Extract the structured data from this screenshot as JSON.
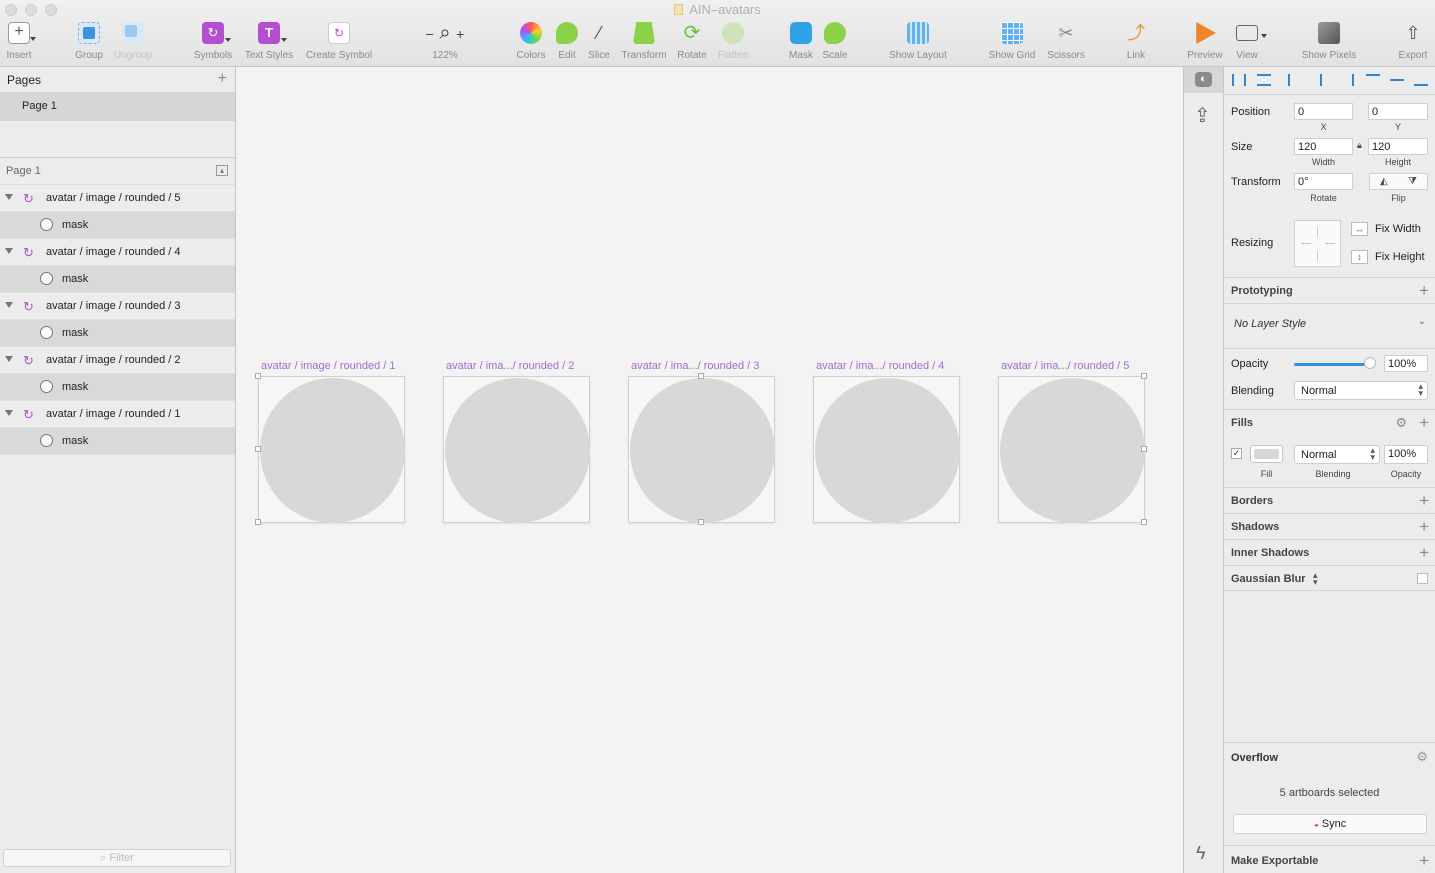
{
  "window": {
    "title": "AIN–avatars"
  },
  "toolbar": {
    "insert": "Insert",
    "group": "Group",
    "ungroup": "Ungroup",
    "symbols": "Symbols",
    "text_styles": "Text Styles",
    "create_symbol": "Create Symbol",
    "zoom": "122%",
    "colors": "Colors",
    "edit": "Edit",
    "slice": "Slice",
    "transform": "Transform",
    "rotate": "Rotate",
    "flatten": "Flatten",
    "mask": "Mask",
    "scale": "Scale",
    "show_layout": "Show Layout",
    "show_grid": "Show Grid",
    "scissors": "Scissors",
    "link": "Link",
    "preview": "Preview",
    "view": "View",
    "show_pixels": "Show Pixels",
    "export": "Export"
  },
  "pages": {
    "header": "Pages",
    "items": [
      {
        "label": "Page 1"
      }
    ]
  },
  "layers": {
    "header": "Page 1",
    "items": [
      {
        "name": "avatar / image / rounded / 5",
        "child": "mask"
      },
      {
        "name": "avatar / image / rounded / 4",
        "child": "mask"
      },
      {
        "name": "avatar / image / rounded / 3",
        "child": "mask"
      },
      {
        "name": "avatar / image / rounded / 2",
        "child": "mask"
      },
      {
        "name": "avatar / image / rounded / 1",
        "child": "mask"
      }
    ],
    "filter_placeholder": "Filter"
  },
  "canvas": {
    "artboards": [
      {
        "label": "avatar / image / rounded / 1"
      },
      {
        "label": "avatar / ima.../ rounded / 2"
      },
      {
        "label": "avatar / ima.../ rounded / 3"
      },
      {
        "label": "avatar / ima.../ rounded / 4"
      },
      {
        "label": "avatar / ima.../ rounded / 5"
      }
    ]
  },
  "inspector": {
    "position": {
      "label": "Position",
      "x": "0",
      "y": "0",
      "x_label": "X",
      "y_label": "Y"
    },
    "size": {
      "label": "Size",
      "width": "120",
      "height": "120",
      "width_label": "Width",
      "height_label": "Height"
    },
    "transform": {
      "label": "Transform",
      "rotate": "0°",
      "rotate_label": "Rotate",
      "flip_label": "Flip"
    },
    "resizing": {
      "label": "Resizing",
      "fix_width": "Fix Width",
      "fix_height": "Fix Height"
    },
    "prototyping": "Prototyping",
    "layer_style": "No Layer Style",
    "opacity": {
      "label": "Opacity",
      "value": "100%",
      "level": 1.0
    },
    "blending": {
      "label": "Blending",
      "value": "Normal"
    },
    "fills": {
      "label": "Fills",
      "blend": "Normal",
      "opacity": "100%",
      "fill_label": "Fill",
      "blending_label": "Blending",
      "opacity_label": "Opacity"
    },
    "borders": "Borders",
    "shadows": "Shadows",
    "inner_shadows": "Inner Shadows",
    "gaussian_blur": "Gaussian Blur",
    "overflow": "Overflow",
    "selection_status": "5 artboards selected",
    "sync": "Sync",
    "make_exportable": "Make Exportable"
  },
  "colors": {
    "accent": "#b44fd2",
    "blue": "#2f86d8",
    "artboard_label": "#a46ad0"
  }
}
